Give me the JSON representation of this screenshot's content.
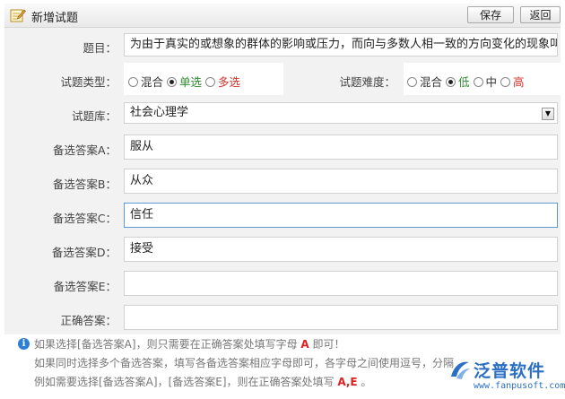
{
  "header": {
    "title": "新增试题",
    "save_label": "保存",
    "back_label": "返回"
  },
  "form": {
    "question": {
      "label": "题目：",
      "value": "为由于真实的或想象的群体的影响或压力，而向与多数人相一致的方向变化的现象叫"
    },
    "type": {
      "label": "试题类型：",
      "options": [
        {
          "text": "混合",
          "checked": false,
          "color": "#333333"
        },
        {
          "text": "单选",
          "checked": true,
          "color": "#2e8b2e"
        },
        {
          "text": "多选",
          "checked": false,
          "color": "#d0352d"
        }
      ]
    },
    "difficulty": {
      "label": "试题难度：",
      "options": [
        {
          "text": "混合",
          "checked": false,
          "color": "#333333"
        },
        {
          "text": "低",
          "checked": true,
          "color": "#2e8b2e"
        },
        {
          "text": "中",
          "checked": false,
          "color": "#333333"
        },
        {
          "text": "高",
          "checked": false,
          "color": "#d0352d"
        }
      ]
    },
    "bank": {
      "label": "试题库：",
      "value": "社会心理学",
      "arrow": "▼"
    },
    "answers": [
      {
        "label": "备选答案A：",
        "value": "服从"
      },
      {
        "label": "备选答案B：",
        "value": "从众"
      },
      {
        "label": "备选答案C：",
        "value": "信任",
        "focused": true
      },
      {
        "label": "备选答案D：",
        "value": "接受"
      },
      {
        "label": "备选答案E：",
        "value": ""
      }
    ],
    "correct": {
      "label": "正确答案：",
      "value": ""
    }
  },
  "hint": {
    "icon": "info-icon",
    "line1_a": "如果选择[备选答案A]，则只需要在正确答案处填写字母 ",
    "line1_hl": "A",
    "line1_b": " 即可！",
    "line2": "如果同时选择多个备选答案，填写各备选答案相应字母即可，各字母之间使用逗号，分隔",
    "line3_a": "例如需要选择[备选答案A]，[备选答案E]，则在正确答案处填写 ",
    "line3_hl": "A,E",
    "line3_b": " 。"
  },
  "watermark": {
    "brand": "泛普软件",
    "url": "www.fanpusoft.com"
  },
  "colors": {
    "focus_border": "#5b9bd5",
    "row_bg": "#f2f2f2",
    "accent": "#2b6fc4"
  }
}
